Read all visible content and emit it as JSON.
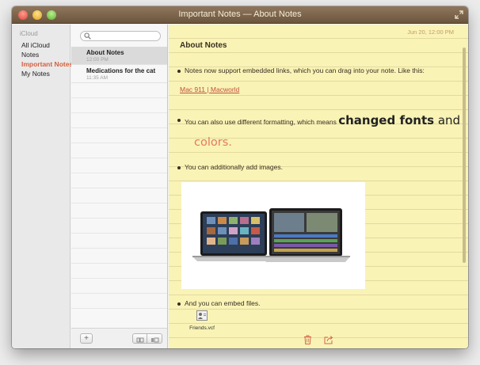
{
  "window": {
    "title": "Important Notes — About Notes"
  },
  "sidebar": {
    "header": "iCloud",
    "items": [
      {
        "label": "All iCloud",
        "active": false
      },
      {
        "label": "Notes",
        "active": false
      },
      {
        "label": "Important Notes",
        "active": true
      },
      {
        "label": "My Notes",
        "active": false
      }
    ]
  },
  "search": {
    "placeholder": "",
    "value": ""
  },
  "notes_list": {
    "items": [
      {
        "title": "About Notes",
        "date": "12:00 PM",
        "selected": true
      },
      {
        "title": "Medications for the cat",
        "date": "11:35 AM",
        "selected": false
      }
    ],
    "add_label": "+"
  },
  "editor": {
    "date": "Jun 20, 12:00 PM",
    "title": "About Notes",
    "bullet1": "Notes now support embedded links, which you can drag into your note. Like this:",
    "link": "Mac 911 | Macworld",
    "bullet2_prefix": "You can also use different formatting, which means ",
    "bullet2_big": "changed fonts",
    "bullet2_and": " and",
    "bullet2_colors": "colors.",
    "bullet3": "You can additionally add images.",
    "bullet4": "And you can embed files.",
    "attachment_name": "Friends.vcf"
  },
  "colors": {
    "titlebar": "#7c6449",
    "paper": "#f9f3b6",
    "accent": "#d4603f",
    "link": "#c2503b"
  },
  "icons": {
    "search": "search-icon",
    "trash": "trash-icon",
    "share": "share-icon",
    "fullscreen": "fullscreen-icon",
    "file": "vcard-file-icon"
  }
}
